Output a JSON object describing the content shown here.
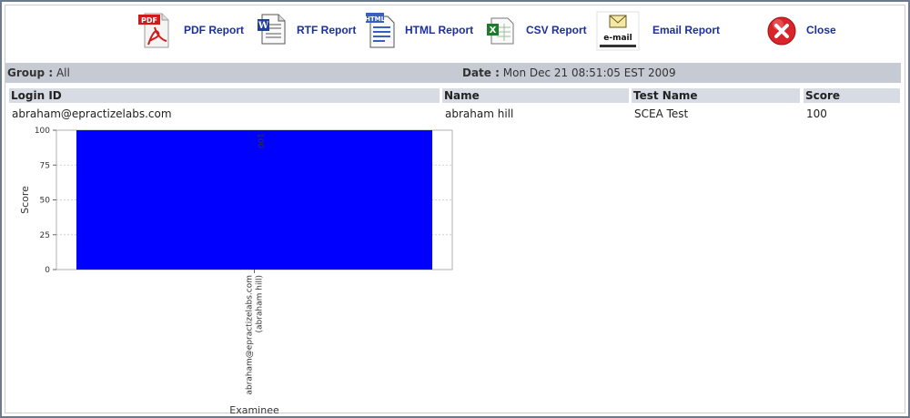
{
  "toolbar": {
    "pdf_label": "PDF Report",
    "pdf_icon_text": "PDF",
    "rtf_label": "RTF Report",
    "html_label": "HTML Report",
    "html_icon_text": "HTML",
    "csv_label": "CSV Report",
    "email_label": "Email Report",
    "email_icon_text": "e-mail",
    "close_label": "Close"
  },
  "info": {
    "group_key": "Group :",
    "group_value": "All",
    "date_key": "Date :",
    "date_value": "Mon Dec 21 08:51:05 EST 2009"
  },
  "table": {
    "headers": [
      "Login ID",
      "Name",
      "Test Name",
      "Score"
    ],
    "rows": [
      [
        "abraham@epractizelabs.com",
        "abraham hill",
        "SCEA Test",
        "100"
      ]
    ]
  },
  "chart_data": {
    "type": "bar",
    "categories": [
      "abraham@epractizelabs.com (abraham hill)"
    ],
    "category_lines": [
      "abraham@epractizelabs.com",
      "(abraham hill)"
    ],
    "values": [
      100
    ],
    "value_labels": [
      "100"
    ],
    "xlabel": "Examinee",
    "ylabel": "Score",
    "ylim": [
      0,
      100
    ],
    "yticks": [
      0,
      25,
      50,
      75,
      100
    ],
    "grid": true,
    "bar_color": "#0000ff"
  },
  "colors": {
    "link": "#1c2fa0",
    "infobar": "#c5cad3",
    "table_header": "#d7dce4",
    "close_red": "#d9252a"
  }
}
